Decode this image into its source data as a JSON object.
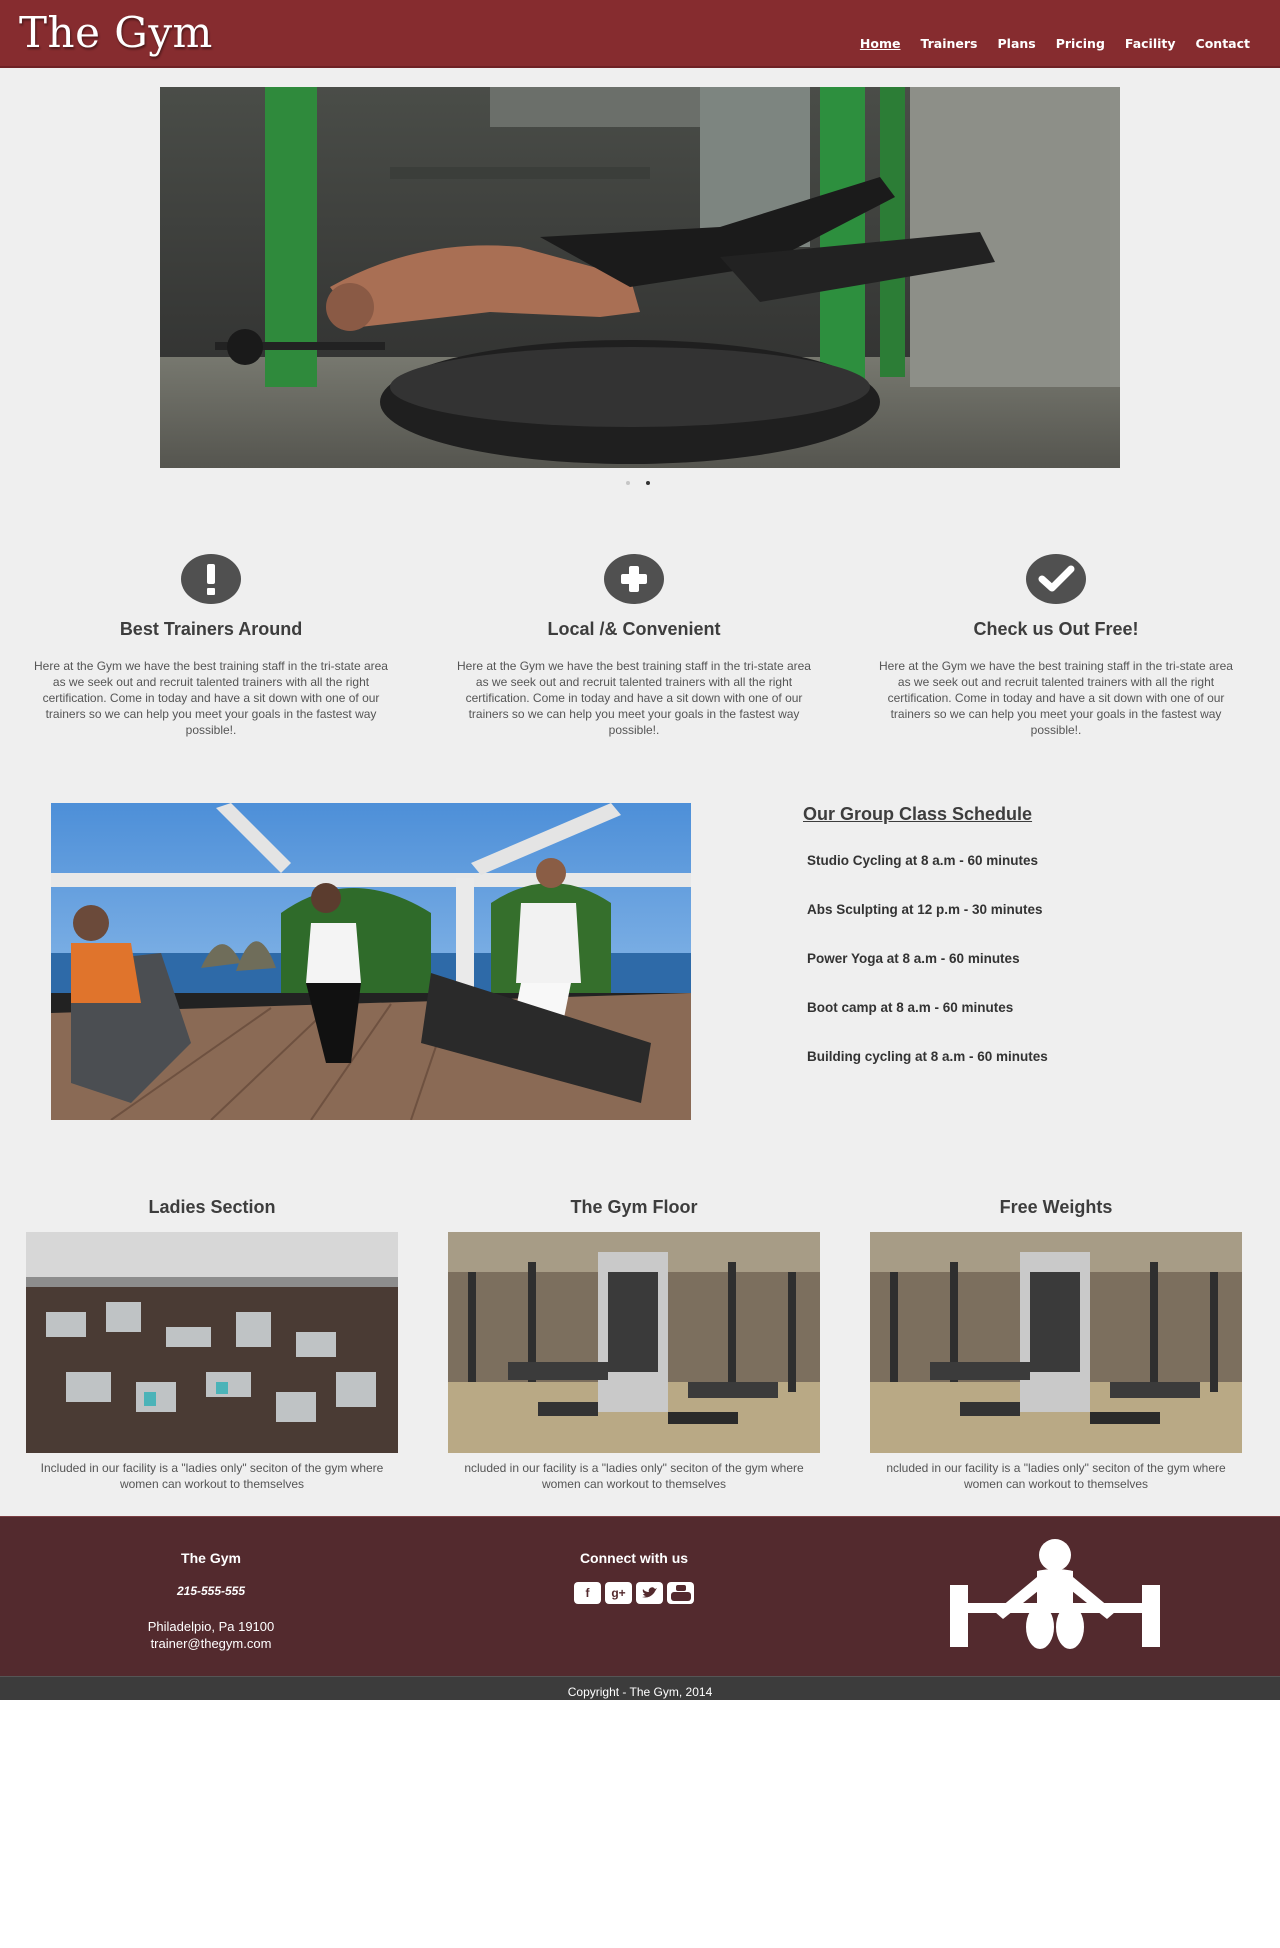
{
  "header": {
    "brand": "The Gym",
    "nav": [
      "Home",
      "Trainers",
      "Plans",
      "Pricing",
      "Facility",
      "Contact"
    ],
    "active_nav": "Home"
  },
  "hero": {
    "slides": 2,
    "active_slide": 2
  },
  "features": [
    {
      "icon": "exclamation-icon",
      "title": "Best Trainers Around",
      "text": "Here at the Gym we have the best training staff in the tri-state area as we seek out and recruit talented trainers with all the right certification. Come in today and have a sit down with one of our trainers so we can help you meet your goals in the fastest way possible!."
    },
    {
      "icon": "plus-icon",
      "title": "Local /& Convenient",
      "text": "Here at the Gym we have the best training staff in the tri-state area as we seek out and recruit talented trainers with all the right certification. Come in today and have a sit down with one of our trainers so we can help you meet your goals in the fastest way possible!."
    },
    {
      "icon": "checkmark-icon",
      "title": "Check us Out Free!",
      "text": "Here at the Gym we have the best training staff in the tri-state area as we seek out and recruit talented trainers with all the right certification. Come in today and have a sit down with one of our trainers so we can help you meet your goals in the fastest way possible!."
    }
  ],
  "schedule": {
    "title": "Our Group Class Schedule",
    "items": [
      "Studio Cycling at 8 a.m - 60 minutes",
      "Abs Sculpting at 12 p.m - 30 minutes",
      "Power Yoga at 8 a.m - 60 minutes",
      "Boot camp at 8 a.m - 60 minutes",
      "Building cycling at 8 a.m - 60 minutes"
    ]
  },
  "facilities": [
    {
      "title": "Ladies Section",
      "text": "Included in our facility is a \"ladies only\" seciton of the gym where women can workout to themselves"
    },
    {
      "title": "The Gym Floor",
      "text": "ncluded in our facility is a \"ladies only\" seciton of the gym where women can workout to themselves"
    },
    {
      "title": "Free Weights",
      "text": "ncluded in our facility is a \"ladies only\" seciton of the gym where women can workout to themselves"
    }
  ],
  "footer": {
    "col1_title": "The Gym",
    "phone": "215-555-555",
    "address": "Philadelpio, Pa 19100",
    "email": "trainer@thegym.com",
    "col2_title": "Connect with us",
    "social": [
      "facebook-icon",
      "google-plus-icon",
      "twitter-icon",
      "youtube-icon"
    ],
    "copyright": "Copyright - The Gym, 2014"
  },
  "colors": {
    "header": "#862c2f",
    "footer": "#532a2e",
    "copyright_bar": "#3c3c3c",
    "page_bg": "#efefef"
  }
}
